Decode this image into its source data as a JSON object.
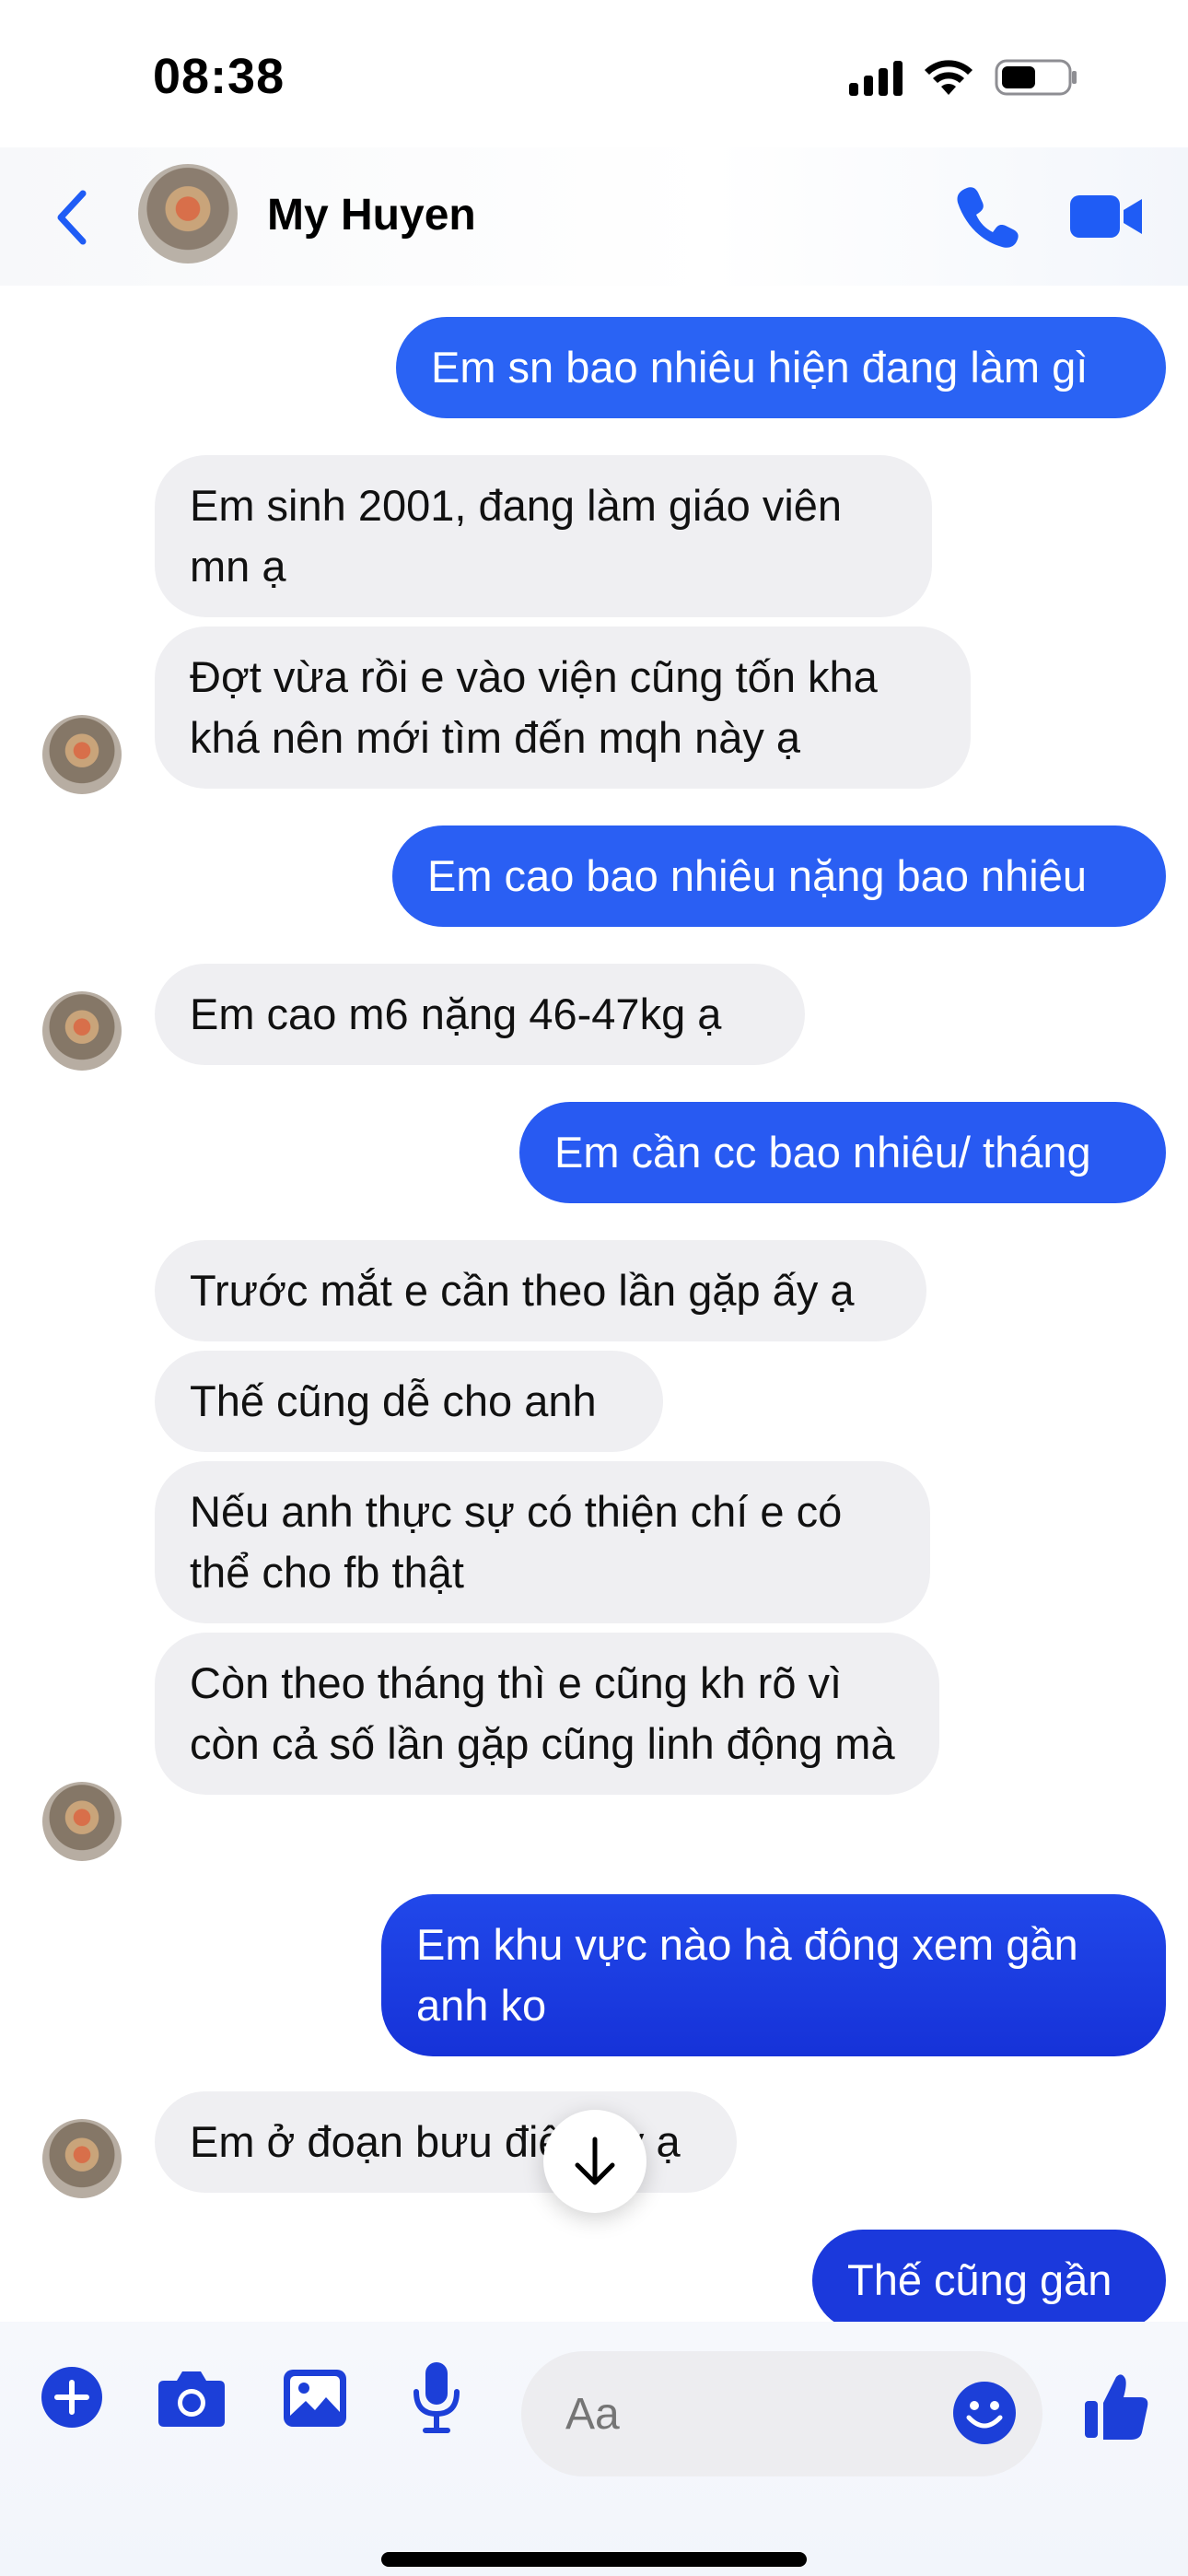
{
  "status_bar": {
    "time": "08:38"
  },
  "header": {
    "contact_name": "My Huyen"
  },
  "messages": [
    {
      "dir": "out",
      "text": "Em sn bao nhiêu hiện đang làm gì"
    },
    {
      "dir": "in",
      "text": "Em sinh 2001, đang làm giáo viên mn ạ"
    },
    {
      "dir": "in",
      "text": "Đợt vừa rồi e vào viện cũng tốn kha khá nên mới tìm đến mqh này ạ"
    },
    {
      "dir": "out",
      "text": "Em cao bao nhiêu nặng bao nhiêu"
    },
    {
      "dir": "in",
      "text": "Em cao m6 nặng 46-47kg ạ"
    },
    {
      "dir": "out",
      "text": "Em cần cc bao nhiêu/ tháng"
    },
    {
      "dir": "in",
      "text": "Trước mắt e cần theo lần gặp ấy ạ"
    },
    {
      "dir": "in",
      "text": "Thế cũng dễ cho anh"
    },
    {
      "dir": "in",
      "text": "Nếu anh thực sự có thiện chí e có thể cho fb thật"
    },
    {
      "dir": "in",
      "text": "Còn theo tháng thì e cũng kh rõ vì còn cả số lần gặp cũng linh động mà"
    },
    {
      "dir": "out",
      "text": "Em khu vực nào hà đông xem gần anh ko"
    },
    {
      "dir": "in",
      "text": "Em ở đoạn bưu điện ấy ạ"
    },
    {
      "dir": "out",
      "text": "Thế cũng gần"
    }
  ],
  "composer": {
    "placeholder": "Aa"
  },
  "colors": {
    "accent": "#1f5cf5",
    "bubble_out_top": "#2a63f4",
    "bubble_out_bottom": "#1632d8",
    "bubble_in": "#efeff2"
  },
  "icons": {
    "back": "chevron-left-icon",
    "call": "phone-icon",
    "video": "video-camera-icon",
    "add": "plus-circle-icon",
    "camera": "camera-icon",
    "gallery": "image-icon",
    "mic": "microphone-icon",
    "emoji": "smiley-icon",
    "like": "thumbs-up-icon",
    "scroll": "arrow-down-icon"
  }
}
